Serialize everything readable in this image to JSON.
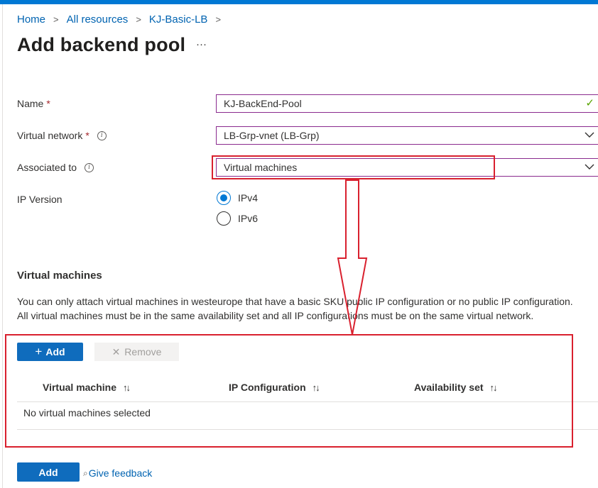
{
  "breadcrumb": {
    "items": [
      "Home",
      "All resources",
      "KJ-Basic-LB"
    ],
    "separator": ">"
  },
  "page": {
    "title": "Add backend pool",
    "more_label": "···"
  },
  "form": {
    "name": {
      "label": "Name",
      "required_mark": "*",
      "value": "KJ-BackEnd-Pool",
      "valid_icon": "✓"
    },
    "virtual_network": {
      "label": "Virtual network",
      "required_mark": "*",
      "info_icon": "i",
      "value": "LB-Grp-vnet (LB-Grp)"
    },
    "associated_to": {
      "label": "Associated to",
      "info_icon": "i",
      "value": "Virtual machines"
    },
    "ip_version": {
      "label": "IP Version",
      "options": [
        "IPv4",
        "IPv6"
      ],
      "selected": "IPv4"
    }
  },
  "vm_section": {
    "title": "Virtual machines",
    "desc_line1": "You can only attach virtual machines in westeurope that have a basic SKU public IP configuration or no public IP configuration.",
    "desc_line2": "All virtual machines must be in the same availability set and all IP configurations must be on the same virtual network.",
    "toolbar": {
      "add_icon": "+",
      "add_label": "Add",
      "remove_icon": "✕",
      "remove_label": "Remove"
    },
    "table": {
      "columns": [
        "Virtual machine",
        "IP Configuration",
        "Availability set"
      ],
      "sort_icon": "↑↓",
      "empty_text": "No virtual machines selected"
    }
  },
  "footer": {
    "add_label": "Add",
    "feedback_icon": "⌕",
    "feedback_label": "Give feedback"
  },
  "colors": {
    "accent": "#0078d4",
    "highlight": "#d9202e",
    "field_border": "#8a2a8e",
    "valid": "#57a300"
  }
}
